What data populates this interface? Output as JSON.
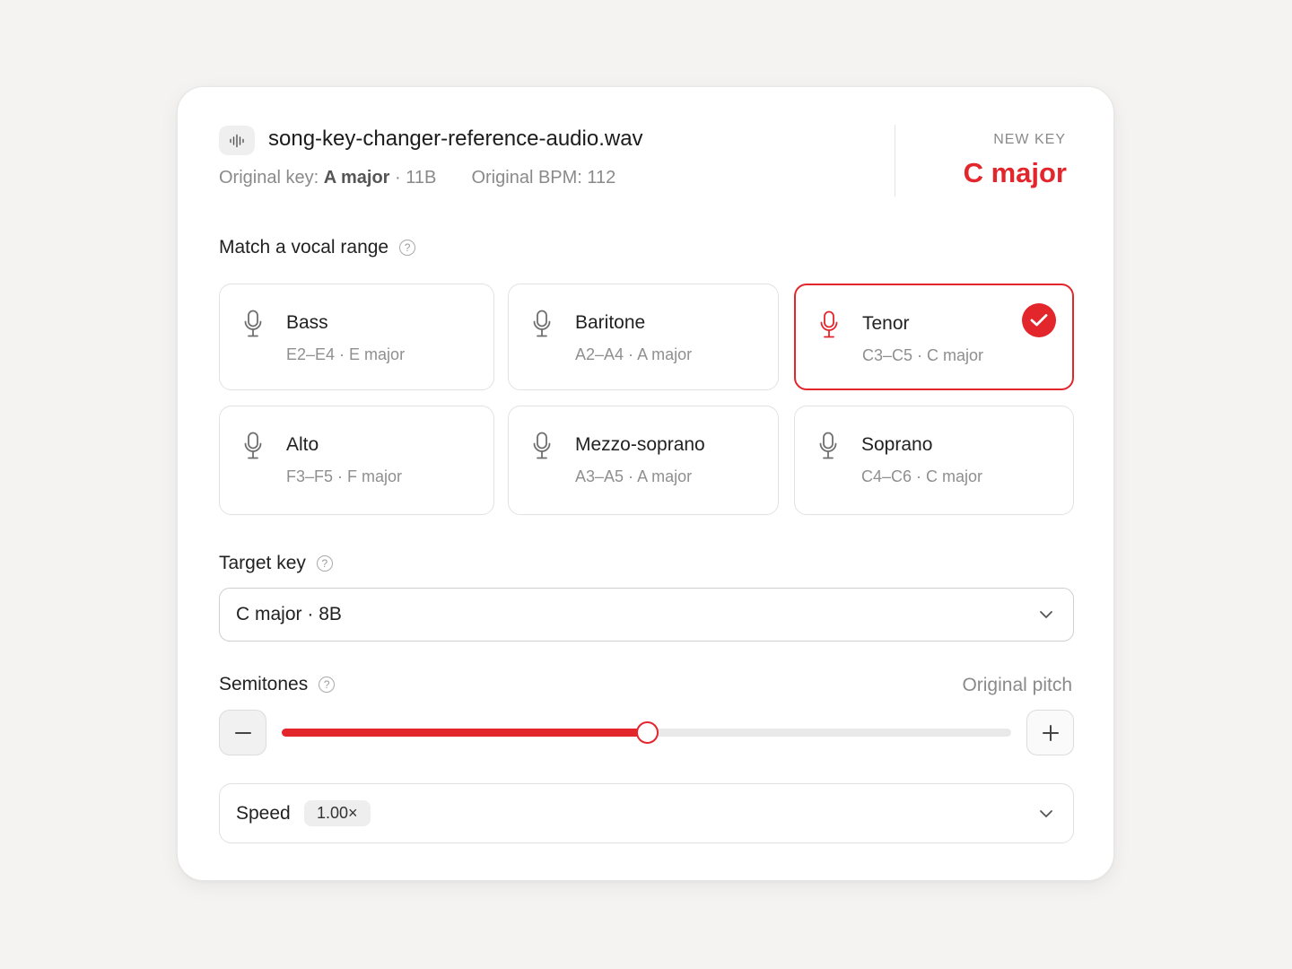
{
  "header": {
    "file_icon": "audio-wave-icon",
    "file_name": "song-key-changer-reference-audio.wav",
    "original_key_label": "Original key:",
    "original_key_value": "A major",
    "original_camelot": "11B",
    "original_bpm": "Original BPM: 112",
    "new_key_label": "NEW KEY",
    "new_key_value": "C major"
  },
  "vocal_range": {
    "label": "Match a vocal range",
    "help_icon": "question-circle-icon",
    "options": [
      {
        "name": "Bass",
        "range": "E2–E4",
        "key": "E major",
        "selected": false
      },
      {
        "name": "Baritone",
        "range": "A2–A4",
        "key": "A major",
        "selected": false
      },
      {
        "name": "Tenor",
        "range": "C3–C5",
        "key": "C major",
        "selected": true
      },
      {
        "name": "Alto",
        "range": "F3–F5",
        "key": "F major",
        "selected": false
      },
      {
        "name": "Mezzo-soprano",
        "range": "A3–A5",
        "key": "A major",
        "selected": false
      },
      {
        "name": "Soprano",
        "range": "C4–C6",
        "key": "C major",
        "selected": false
      }
    ]
  },
  "target_key": {
    "label": "Target key",
    "value": "C major",
    "camelot": "8B"
  },
  "semitones": {
    "label": "Semitones",
    "status": "Original pitch",
    "minus_icon": "minus-icon",
    "plus_icon": "plus-icon",
    "slider_fraction": 0.5
  },
  "speed": {
    "label": "Speed",
    "value": "1.00×"
  },
  "colors": {
    "accent": "#e3262c",
    "muted_text": "#8a8a8a",
    "background": "#f4f3f2"
  }
}
